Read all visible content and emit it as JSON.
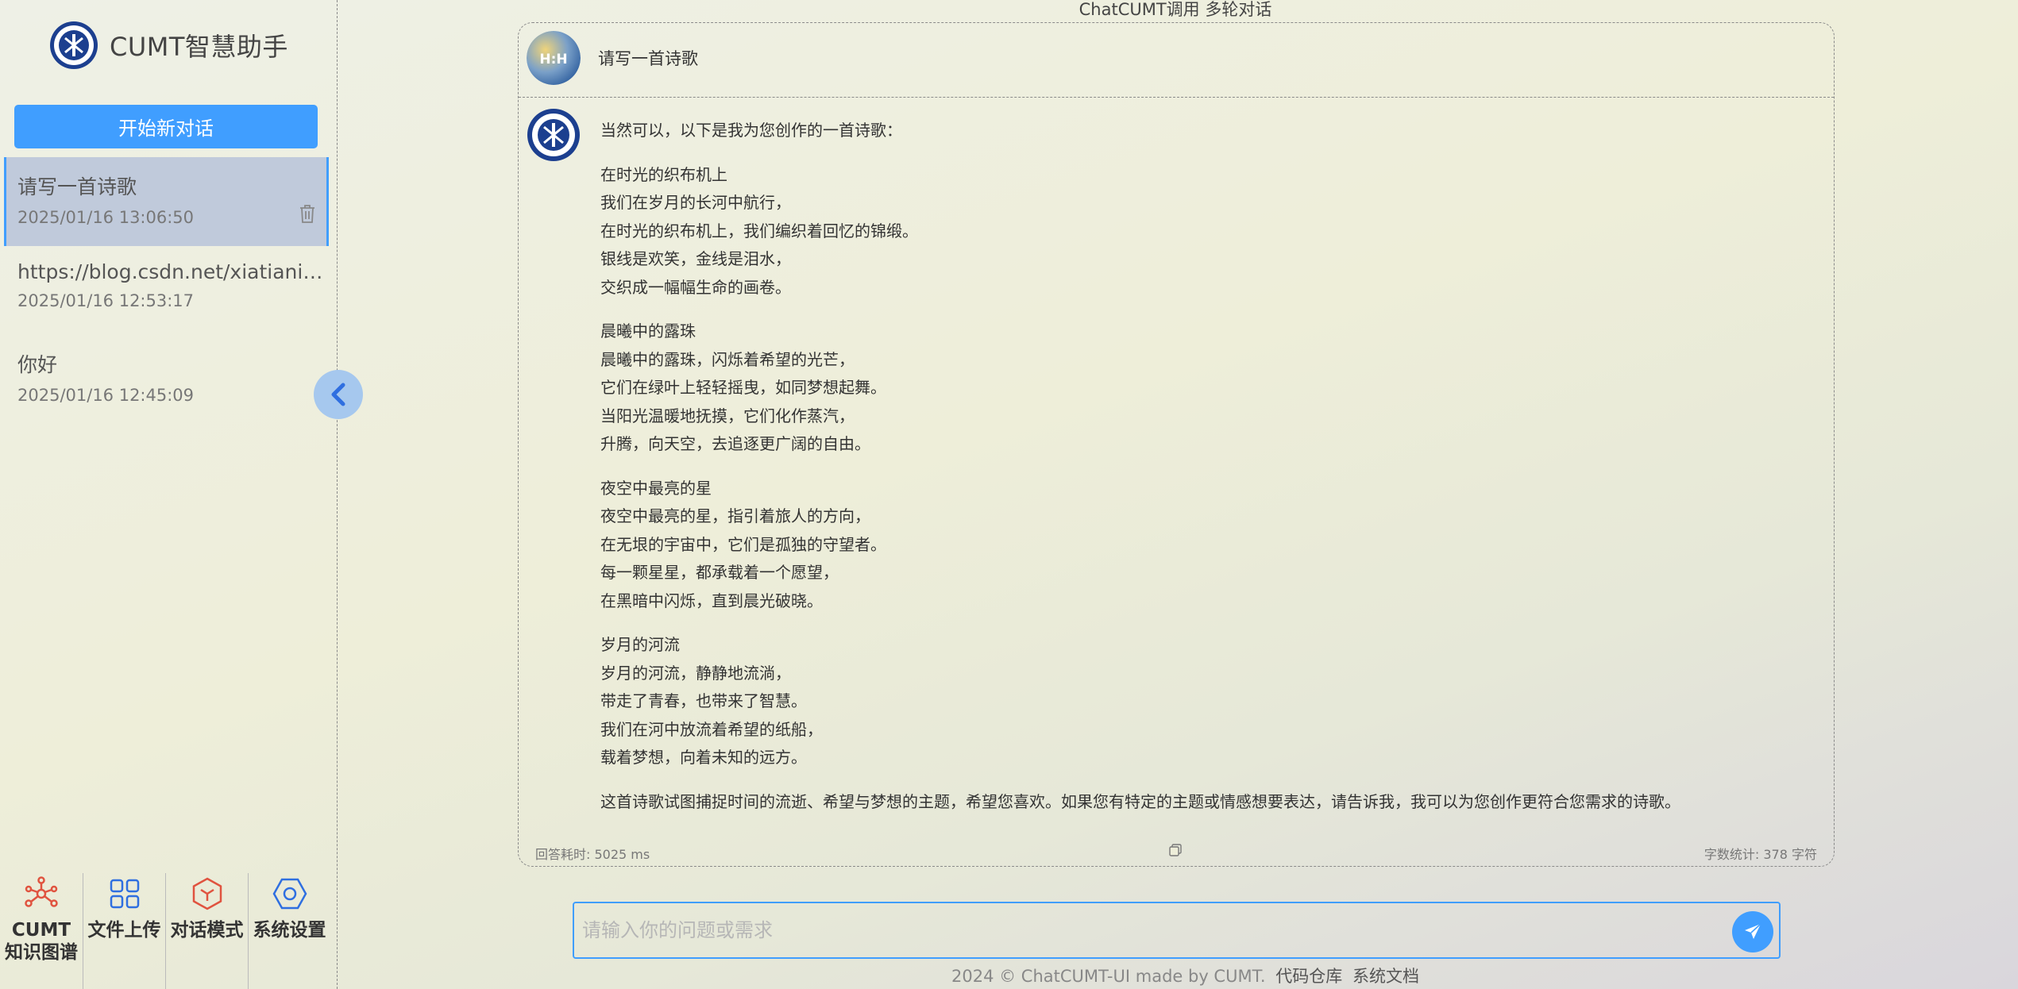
{
  "app": {
    "name": "CUMT智慧助手",
    "page_title": "ChatCUMT调用 多轮对话"
  },
  "sidebar": {
    "new_chat_label": "开始新对话",
    "conversations": [
      {
        "title": "请写一首诗歌",
        "time": "2025/01/16 13:06:50",
        "active": true
      },
      {
        "title": "https://blog.csdn.net/xiatianit/article/details/",
        "time": "2025/01/16 12:53:17",
        "active": false
      },
      {
        "title": "你好",
        "time": "2025/01/16 12:45:09",
        "active": false
      }
    ],
    "toolbar": [
      {
        "label": "CUMT知识图谱",
        "label_lines": [
          "CUMT",
          "知识图谱"
        ],
        "icon": "knowledge-graph-icon",
        "color": "#e0533f"
      },
      {
        "label": "文件上传",
        "icon": "grid-icon",
        "color": "#2f6fe0"
      },
      {
        "label": "对话模式",
        "icon": "cube-icon",
        "color": "#e0533f"
      },
      {
        "label": "系统设置",
        "icon": "settings-hexagon-icon",
        "color": "#2f6fe0"
      }
    ]
  },
  "chat": {
    "question": "请写一首诗歌",
    "answer": {
      "intro": "当然可以，以下是我为您创作的一首诗歌：",
      "stanzas": [
        [
          "在时光的织布机上",
          "我们在岁月的长河中航行，",
          "在时光的织布机上，我们编织着回忆的锦缎。",
          "银线是欢笑，金线是泪水，",
          "交织成一幅幅生命的画卷。"
        ],
        [
          "晨曦中的露珠",
          "晨曦中的露珠，闪烁着希望的光芒，",
          "它们在绿叶上轻轻摇曳，如同梦想起舞。",
          "当阳光温暖地抚摸，它们化作蒸汽，",
          "升腾，向天空，去追逐更广阔的自由。"
        ],
        [
          "夜空中最亮的星",
          "夜空中最亮的星，指引着旅人的方向，",
          "在无垠的宇宙中，它们是孤独的守望者。",
          "每一颗星星，都承载着一个愿望，",
          "在黑暗中闪烁，直到晨光破晓。"
        ],
        [
          "岁月的河流",
          "岁月的河流，静静地流淌，",
          "带走了青春，也带来了智慧。",
          "我们在河中放流着希望的纸船，",
          "载着梦想，向着未知的远方。"
        ]
      ],
      "outro": "这首诗歌试图捕捉时间的流逝、希望与梦想的主题，希望您喜欢。如果您有特定的主题或情感想要表达，请告诉我，我可以为您创作更符合您需求的诗歌。"
    },
    "response_time": "回答耗时: 5025 ms",
    "char_count": "字数统计: 378 字符"
  },
  "input": {
    "placeholder": "请输入你的问题或需求",
    "value": ""
  },
  "footer": {
    "text": "2024 © ChatCUMT-UI made by CUMT.",
    "repo_link": "代码仓库",
    "docs_link": "系统文档"
  },
  "colors": {
    "accent": "#409eff",
    "active_item_bg": "#c0cadb",
    "collapse_btn_bg": "#a6c8ee"
  }
}
